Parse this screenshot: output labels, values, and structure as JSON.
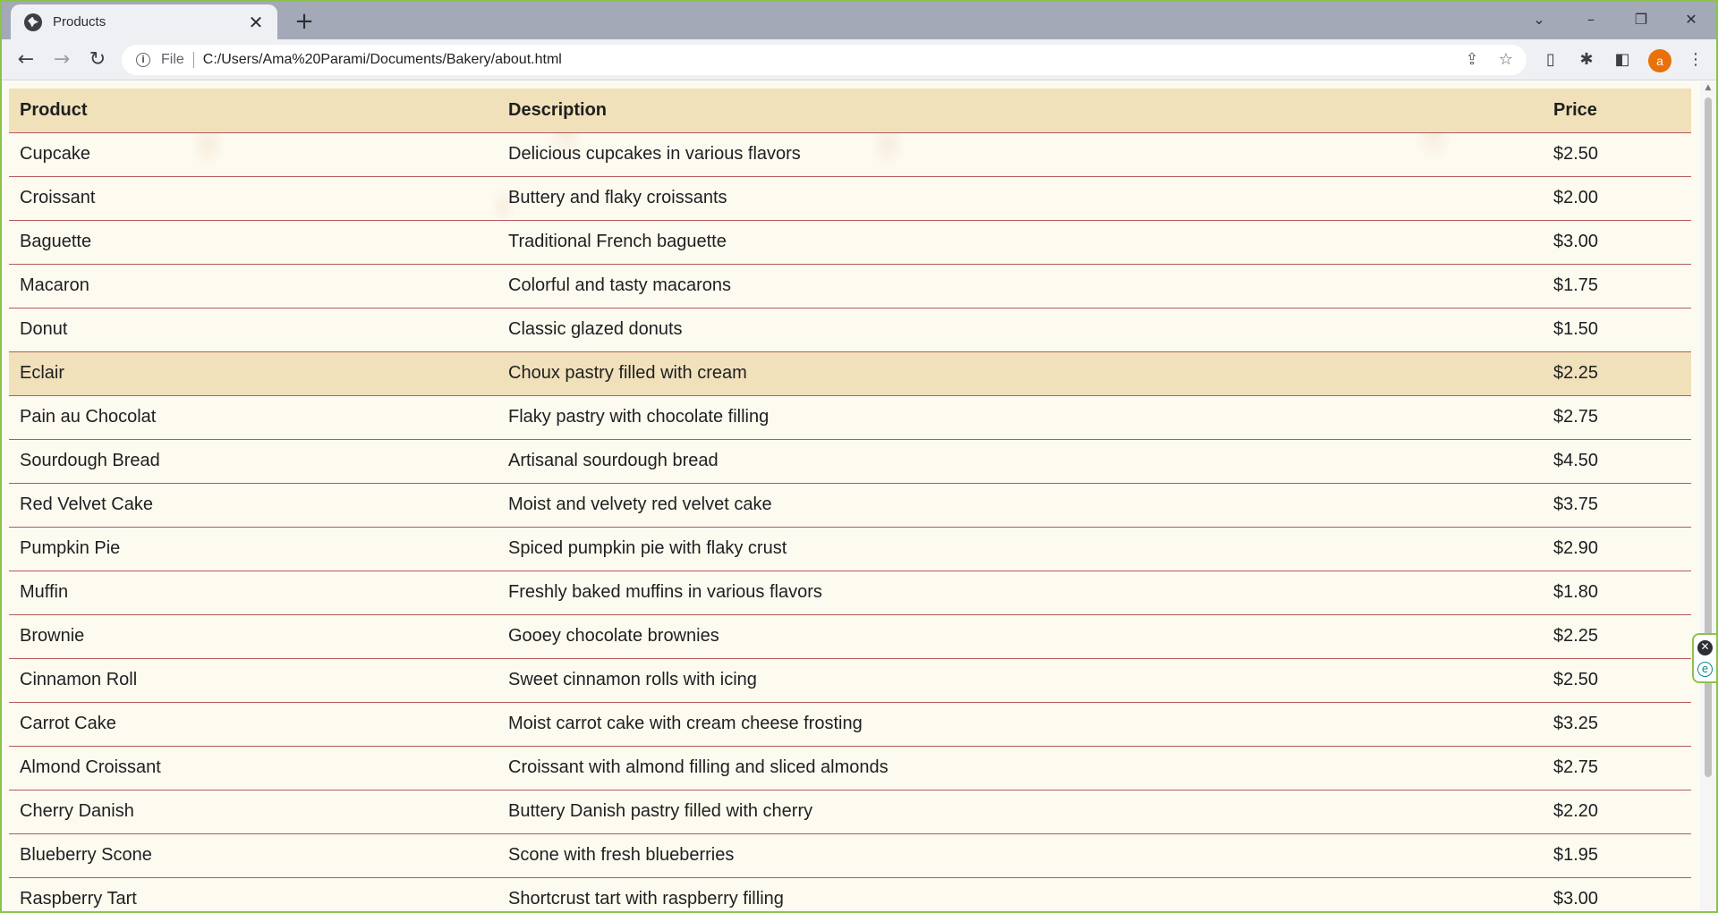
{
  "browser": {
    "tab_title": "Products",
    "tab_close_glyph": "✕",
    "new_tab_glyph": "+",
    "window_controls": [
      "⌄",
      "–",
      "❐",
      "✕"
    ],
    "nav": {
      "back": "←",
      "forward": "→",
      "reload": "↻"
    },
    "omnibox": {
      "info_glyph": "i",
      "scheme_label": "File",
      "url": "C:/Users/Ama%20Parami/Documents/Bakery/about.html",
      "share_glyph": "⇪",
      "bookmark_glyph": "☆"
    },
    "toolbar_icons": {
      "page": "▯",
      "extensions": "✱",
      "side_panel": "◧",
      "menu": "⋮"
    },
    "profile_initial": "a",
    "profile_color": "#e8710a"
  },
  "table": {
    "headers": {
      "product": "Product",
      "description": "Description",
      "price": "Price"
    },
    "rows": [
      {
        "product": "Cupcake",
        "description": "Delicious cupcakes in various flavors",
        "price": "$2.50"
      },
      {
        "product": "Croissant",
        "description": "Buttery and flaky croissants",
        "price": "$2.00"
      },
      {
        "product": "Baguette",
        "description": "Traditional French baguette",
        "price": "$3.00"
      },
      {
        "product": "Macaron",
        "description": "Colorful and tasty macarons",
        "price": "$1.75"
      },
      {
        "product": "Donut",
        "description": "Classic glazed donuts",
        "price": "$1.50"
      },
      {
        "product": "Eclair",
        "description": "Choux pastry filled with cream",
        "price": "$2.25"
      },
      {
        "product": "Pain au Chocolat",
        "description": "Flaky pastry with chocolate filling",
        "price": "$2.75"
      },
      {
        "product": "Sourdough Bread",
        "description": "Artisanal sourdough bread",
        "price": "$4.50"
      },
      {
        "product": "Red Velvet Cake",
        "description": "Moist and velvety red velvet cake",
        "price": "$3.75"
      },
      {
        "product": "Pumpkin Pie",
        "description": "Spiced pumpkin pie with flaky crust",
        "price": "$2.90"
      },
      {
        "product": "Muffin",
        "description": "Freshly baked muffins in various flavors",
        "price": "$1.80"
      },
      {
        "product": "Brownie",
        "description": "Gooey chocolate brownies",
        "price": "$2.25"
      },
      {
        "product": "Cinnamon Roll",
        "description": "Sweet cinnamon rolls with icing",
        "price": "$2.50"
      },
      {
        "product": "Carrot Cake",
        "description": "Moist carrot cake with cream cheese frosting",
        "price": "$3.25"
      },
      {
        "product": "Almond Croissant",
        "description": "Croissant with almond filling and sliced almonds",
        "price": "$2.75"
      },
      {
        "product": "Cherry Danish",
        "description": "Buttery Danish pastry filled with cherry",
        "price": "$2.20"
      },
      {
        "product": "Blueberry Scone",
        "description": "Scone with fresh blueberries",
        "price": "$1.95"
      },
      {
        "product": "Raspberry Tart",
        "description": "Shortcrust tart with raspberry filling",
        "price": "$3.00"
      }
    ],
    "hovered_row": "Eclair"
  },
  "side_widget": {
    "close_glyph": "✕",
    "extra_glyph": "e"
  },
  "colors": {
    "header_bg": "#f0e1bb",
    "row_border": "#b35b5b",
    "page_bg": "#fdfaf0",
    "window_frame": "#8bc34a"
  }
}
